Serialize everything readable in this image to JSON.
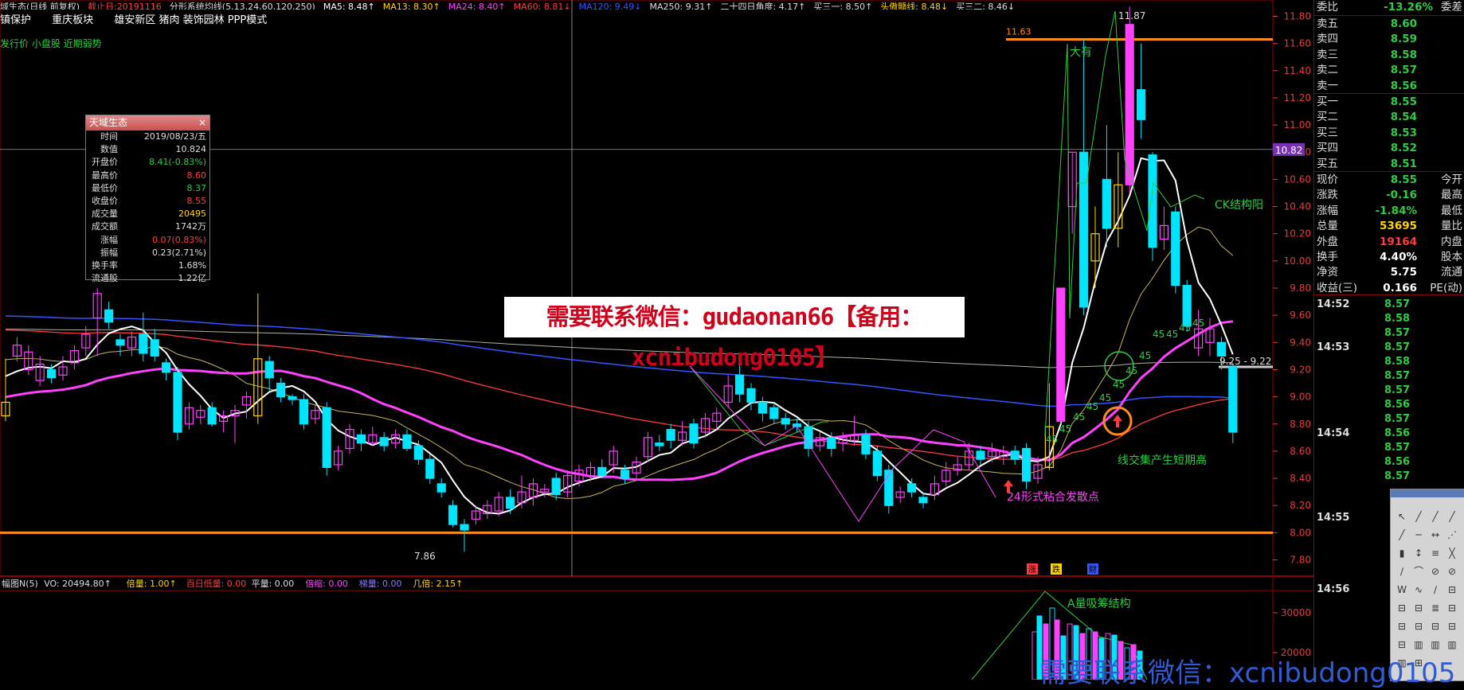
{
  "header": {
    "indicators": [
      {
        "text": "域生态(日线 前复权)",
        "color": "#dddddd"
      },
      {
        "text": "截止日:20191116",
        "color": "#ff3b3b"
      },
      {
        "text": "分形系统均线(5,13,24,60,120,250)",
        "color": "#dddddd"
      },
      {
        "text": "MA5: 8.48↑",
        "color": "#ffffff"
      },
      {
        "text": "MA13: 8.30↑",
        "color": "#ffd400"
      },
      {
        "text": "MA24: 8.40↑",
        "color": "#ff40ff"
      },
      {
        "text": "MA60: 8.81↓",
        "color": "#ff3b3b"
      },
      {
        "text": "MA120: 9.49↓",
        "color": "#3355ff"
      },
      {
        "text": "MA250: 9.31↑",
        "color": "#dddddd"
      },
      {
        "text": "二十四日角度: 4.17↑",
        "color": "#dddddd"
      },
      {
        "text": "买三一: 8.50↑",
        "color": "#dddddd"
      },
      {
        "text": "头傲髓线: 8.48↓",
        "color": "#ffd400"
      },
      {
        "text": "买三二: 8.46↓",
        "color": "#dddddd"
      }
    ],
    "tags": [
      "镇保护",
      "重庆板块",
      "雄安新区 猪肉 装饰园林 PPP模式"
    ],
    "subtitle": "发行价 小盘股 近期弱势"
  },
  "info_popup": {
    "title": "天域生态",
    "close": "×",
    "rows": [
      {
        "k": "时间",
        "v": "2019/08/23/五",
        "color": "#dddddd"
      },
      {
        "k": "数值",
        "v": "10.824",
        "color": "#dddddd"
      },
      {
        "k": "开盘价",
        "v": "8.41(-0.83%)",
        "color": "#2ecc40"
      },
      {
        "k": "最高价",
        "v": "8.60",
        "color": "#ff3b3b"
      },
      {
        "k": "最低价",
        "v": "8.37",
        "color": "#2ecc40"
      },
      {
        "k": "收盘价",
        "v": "8.55",
        "color": "#ff3b3b"
      },
      {
        "k": "成交量",
        "v": "20495",
        "color": "#ffd400"
      },
      {
        "k": "成交额",
        "v": "1742万",
        "color": "#dddddd"
      },
      {
        "k": "涨幅",
        "v": "0.07(0.83%)",
        "color": "#ff3b3b"
      },
      {
        "k": "振幅",
        "v": "0.23(2.71%)",
        "color": "#dddddd"
      },
      {
        "k": "换手率",
        "v": "1.68%",
        "color": "#dddddd"
      },
      {
        "k": "流通股",
        "v": "1.22亿",
        "color": "#dddddd"
      }
    ]
  },
  "banner": "需要联系微信：gudaonan66【备用：xcnibudong0105】",
  "watermark": "需要联系微信：xcnibudong0105",
  "annotations": {
    "label_11_63": "11.63",
    "label_11_87": "11.87",
    "label_7_86": "7.86",
    "dayou": "大有",
    "ck": "CK结构阳",
    "short_high": "线交集产生短期高",
    "divergence": "24形式粘合发散点",
    "range_925": "9.25 - 9.22",
    "cursor_price": "10.82",
    "vol_struct": "A量吸筹结构",
    "fortyfive": "45",
    "markers": [
      "涨",
      "跌",
      "财"
    ]
  },
  "volume_header": [
    {
      "text": "幅图N(5)",
      "color": "#dddddd"
    },
    {
      "text": "VO: 20494.80↑",
      "color": "#dddddd"
    },
    {
      "text": "倍量: 1.00↑",
      "color": "#ffd400"
    },
    {
      "text": "百日低量: 0.00",
      "color": "#ff3b3b"
    },
    {
      "text": "平量: 0.00",
      "color": "#dddddd"
    },
    {
      "text": "倍缩: 0.00",
      "color": "#ff40ff"
    },
    {
      "text": "梯量: 0.00",
      "color": "#8877ff"
    },
    {
      "text": "几倍: 2.15↑",
      "color": "#ffd400"
    }
  ],
  "panel": {
    "top": {
      "lbl": "委比",
      "val": "-13.26%",
      "lbl2": "委差"
    },
    "sells": [
      {
        "lbl": "卖五",
        "val": "8.60"
      },
      {
        "lbl": "卖四",
        "val": "8.59"
      },
      {
        "lbl": "卖三",
        "val": "8.58"
      },
      {
        "lbl": "卖二",
        "val": "8.57"
      },
      {
        "lbl": "卖一",
        "val": "8.56"
      }
    ],
    "buys": [
      {
        "lbl": "买一",
        "val": "8.55"
      },
      {
        "lbl": "买二",
        "val": "8.54"
      },
      {
        "lbl": "买三",
        "val": "8.53"
      },
      {
        "lbl": "买四",
        "val": "8.52"
      },
      {
        "lbl": "买五",
        "val": "8.51"
      }
    ],
    "stats": [
      {
        "lbl": "现价",
        "val": "8.55",
        "color": "#2ecc40",
        "lbl2": "今开"
      },
      {
        "lbl": "涨跌",
        "val": "-0.16",
        "color": "#2ecc40",
        "lbl2": "最高"
      },
      {
        "lbl": "涨幅",
        "val": "-1.84%",
        "color": "#2ecc40",
        "lbl2": "最低"
      },
      {
        "lbl": "总量",
        "val": "53695",
        "color": "#ffd400",
        "lbl2": "量比"
      },
      {
        "lbl": "外盘",
        "val": "19164",
        "color": "#ff3b3b",
        "lbl2": "内盘"
      },
      {
        "lbl": "换手",
        "val": "4.40%",
        "color": "#ffffff",
        "lbl2": "股本"
      },
      {
        "lbl": "净资",
        "val": "5.75",
        "color": "#ffffff",
        "lbl2": "流通"
      },
      {
        "lbl": "收益(三)",
        "val": "0.166",
        "color": "#ffffff",
        "lbl2": "PE(动)"
      }
    ],
    "ticks": [
      {
        "t": "14:52",
        "p": "8.57"
      },
      {
        "t": "",
        "p": "8.58"
      },
      {
        "t": "",
        "p": "8.57"
      },
      {
        "t": "14:53",
        "p": "8.57"
      },
      {
        "t": "",
        "p": "8.58"
      },
      {
        "t": "",
        "p": "8.57"
      },
      {
        "t": "",
        "p": "8.57"
      },
      {
        "t": "",
        "p": "8.56"
      },
      {
        "t": "",
        "p": "8.57"
      },
      {
        "t": "14:54",
        "p": "8.56"
      },
      {
        "t": "",
        "p": "8.57"
      },
      {
        "t": "",
        "p": "8.56"
      },
      {
        "t": "",
        "p": "8.57"
      },
      {
        "t": "14:55",
        "p": ""
      },
      {
        "t": "14:56",
        "p": ""
      }
    ]
  },
  "colors": {
    "up": "#ff40ff",
    "down": "#00e5ff",
    "ma5": "#ffffff",
    "ma13": "#c8b45a",
    "ma24": "#ff40ff",
    "ma60": "#ff3b3b",
    "ma120": "#3355ff",
    "ma250": "#b0b0a0",
    "axis": "#e23b3b",
    "hline": "#ff8c1a"
  },
  "chart_data": {
    "type": "candlestick",
    "y_axis_ticks": [
      7.8,
      8.0,
      8.2,
      8.4,
      8.6,
      8.8,
      9.0,
      9.2,
      9.4,
      9.6,
      9.8,
      10.0,
      10.2,
      10.4,
      10.6,
      10.8,
      11.0,
      11.2,
      11.4,
      11.6,
      11.8
    ],
    "ylim": [
      7.68,
      11.92
    ],
    "volume_ticks": [
      20000,
      30000
    ],
    "horizontal_lines": [
      8.0,
      11.63
    ],
    "candles": [
      [
        8.86,
        8.96,
        8.82,
        9.28
      ],
      [
        9.3,
        9.38,
        9.26,
        9.44
      ],
      [
        9.2,
        9.33,
        9.16,
        9.38
      ],
      [
        9.12,
        9.24,
        9.08,
        9.3
      ],
      [
        9.2,
        9.14,
        9.1,
        9.24
      ],
      [
        9.16,
        9.22,
        9.12,
        9.3
      ],
      [
        9.25,
        9.34,
        9.2,
        9.38
      ],
      [
        9.36,
        9.46,
        9.3,
        9.52
      ],
      [
        9.58,
        9.76,
        9.3,
        9.8
      ],
      [
        9.64,
        9.55,
        9.5,
        9.7
      ],
      [
        9.42,
        9.38,
        9.3,
        9.46
      ],
      [
        9.36,
        9.44,
        9.3,
        9.48
      ],
      [
        9.46,
        9.32,
        9.26,
        9.62
      ],
      [
        9.42,
        9.3,
        9.26,
        9.5
      ],
      [
        9.25,
        9.18,
        9.12,
        9.28
      ],
      [
        9.18,
        8.74,
        8.68,
        9.22
      ],
      [
        8.8,
        8.92,
        8.76,
        8.96
      ],
      [
        8.85,
        8.9,
        8.8,
        8.94
      ],
      [
        8.92,
        8.8,
        8.78,
        8.96
      ],
      [
        8.82,
        8.86,
        8.74,
        8.9
      ],
      [
        8.86,
        8.9,
        8.66,
        8.94
      ],
      [
        8.94,
        9.0,
        8.84,
        9.04
      ],
      [
        8.86,
        9.28,
        8.8,
        9.76
      ],
      [
        9.26,
        9.14,
        9.04,
        9.3
      ],
      [
        9.1,
        9.0,
        8.96,
        9.14
      ],
      [
        9.0,
        8.98,
        8.94,
        9.02
      ],
      [
        8.98,
        8.8,
        8.76,
        9.02
      ],
      [
        8.84,
        8.9,
        8.8,
        8.94
      ],
      [
        8.92,
        8.48,
        8.42,
        8.96
      ],
      [
        8.5,
        8.6,
        8.46,
        8.64
      ],
      [
        8.62,
        8.76,
        8.58,
        8.8
      ],
      [
        8.72,
        8.66,
        8.6,
        8.76
      ],
      [
        8.66,
        8.72,
        8.64,
        8.78
      ],
      [
        8.7,
        8.64,
        8.6,
        8.74
      ],
      [
        8.66,
        8.72,
        8.62,
        8.76
      ],
      [
        8.72,
        8.62,
        8.6,
        8.76
      ],
      [
        8.64,
        8.54,
        8.5,
        8.68
      ],
      [
        8.54,
        8.4,
        8.36,
        8.58
      ],
      [
        8.36,
        8.3,
        8.26,
        8.4
      ],
      [
        8.2,
        8.06,
        8.04,
        8.24
      ],
      [
        8.06,
        8.02,
        7.86,
        8.1
      ],
      [
        8.1,
        8.16,
        8.06,
        8.2
      ],
      [
        8.14,
        8.2,
        8.1,
        8.24
      ],
      [
        8.16,
        8.26,
        8.12,
        8.3
      ],
      [
        8.26,
        8.18,
        8.14,
        8.32
      ],
      [
        8.22,
        8.3,
        8.18,
        8.42
      ],
      [
        8.26,
        8.36,
        8.2,
        8.4
      ],
      [
        8.3,
        8.32,
        8.26,
        8.36
      ],
      [
        8.4,
        8.28,
        8.24,
        8.44
      ],
      [
        8.3,
        8.42,
        8.26,
        8.46
      ],
      [
        8.38,
        8.46,
        8.34,
        8.5
      ],
      [
        8.42,
        8.48,
        8.38,
        8.52
      ],
      [
        8.48,
        8.42,
        8.4,
        8.54
      ],
      [
        8.5,
        8.6,
        8.44,
        8.64
      ],
      [
        8.46,
        8.4,
        8.36,
        8.5
      ],
      [
        8.44,
        8.52,
        8.4,
        8.56
      ],
      [
        8.56,
        8.7,
        8.52,
        8.74
      ],
      [
        8.66,
        8.64,
        8.6,
        8.72
      ],
      [
        8.76,
        8.68,
        8.62,
        8.8
      ],
      [
        8.68,
        8.74,
        8.64,
        8.82
      ],
      [
        8.8,
        8.66,
        8.62,
        8.84
      ],
      [
        8.74,
        8.84,
        8.7,
        8.88
      ],
      [
        8.82,
        8.88,
        8.76,
        8.92
      ],
      [
        8.96,
        9.08,
        8.92,
        9.16
      ],
      [
        9.16,
        9.02,
        8.96,
        9.26
      ],
      [
        9.06,
        8.96,
        8.9,
        9.1
      ],
      [
        8.96,
        8.88,
        8.82,
        9.0
      ],
      [
        8.92,
        8.84,
        8.8,
        8.96
      ],
      [
        8.84,
        8.8,
        8.76,
        8.88
      ],
      [
        8.8,
        8.78,
        8.74,
        8.84
      ],
      [
        8.78,
        8.62,
        8.56,
        8.82
      ],
      [
        8.64,
        8.7,
        8.6,
        8.74
      ],
      [
        8.7,
        8.62,
        8.56,
        8.74
      ],
      [
        8.66,
        8.7,
        8.6,
        8.74
      ],
      [
        8.68,
        8.72,
        8.64,
        8.86
      ],
      [
        8.72,
        8.58,
        8.54,
        8.76
      ],
      [
        8.6,
        8.42,
        8.38,
        8.64
      ],
      [
        8.46,
        8.2,
        8.14,
        8.5
      ],
      [
        8.26,
        8.3,
        8.22,
        8.34
      ],
      [
        8.36,
        8.3,
        8.26,
        8.4
      ],
      [
        8.26,
        8.22,
        8.18,
        8.3
      ],
      [
        8.28,
        8.36,
        8.24,
        8.42
      ],
      [
        8.38,
        8.46,
        8.34,
        8.52
      ],
      [
        8.46,
        8.5,
        8.42,
        8.56
      ],
      [
        8.5,
        8.6,
        8.46,
        8.66
      ],
      [
        8.6,
        8.54,
        8.5,
        8.64
      ],
      [
        8.56,
        8.6,
        8.52,
        8.66
      ],
      [
        8.56,
        8.6,
        8.5,
        8.64
      ],
      [
        8.6,
        8.54,
        8.5,
        8.64
      ],
      [
        8.62,
        8.38,
        8.32,
        8.66
      ],
      [
        8.4,
        8.5,
        8.36,
        8.56
      ],
      [
        8.48,
        8.78,
        8.46,
        9.1
      ],
      [
        8.82,
        9.8,
        8.8,
        9.8
      ],
      [
        10.4,
        10.8,
        10.2,
        10.8
      ],
      [
        10.8,
        9.66,
        9.6,
        11.63
      ],
      [
        10.0,
        10.2,
        9.8,
        10.4
      ],
      [
        10.6,
        10.24,
        10.1,
        11.0
      ],
      [
        10.24,
        10.56,
        10.1,
        10.8
      ],
      [
        10.56,
        11.74,
        10.5,
        11.87
      ],
      [
        11.26,
        11.04,
        10.9,
        11.6
      ],
      [
        10.78,
        10.1,
        10.0,
        10.8
      ],
      [
        10.16,
        10.26,
        10.08,
        10.4
      ],
      [
        10.36,
        9.82,
        9.76,
        10.4
      ],
      [
        9.82,
        9.52,
        9.48,
        9.86
      ],
      [
        9.36,
        9.5,
        9.3,
        9.64
      ],
      [
        9.4,
        9.5,
        9.3,
        9.58
      ],
      [
        9.4,
        9.3,
        9.2,
        9.44
      ],
      [
        9.22,
        8.74,
        8.66,
        9.24
      ]
    ]
  }
}
